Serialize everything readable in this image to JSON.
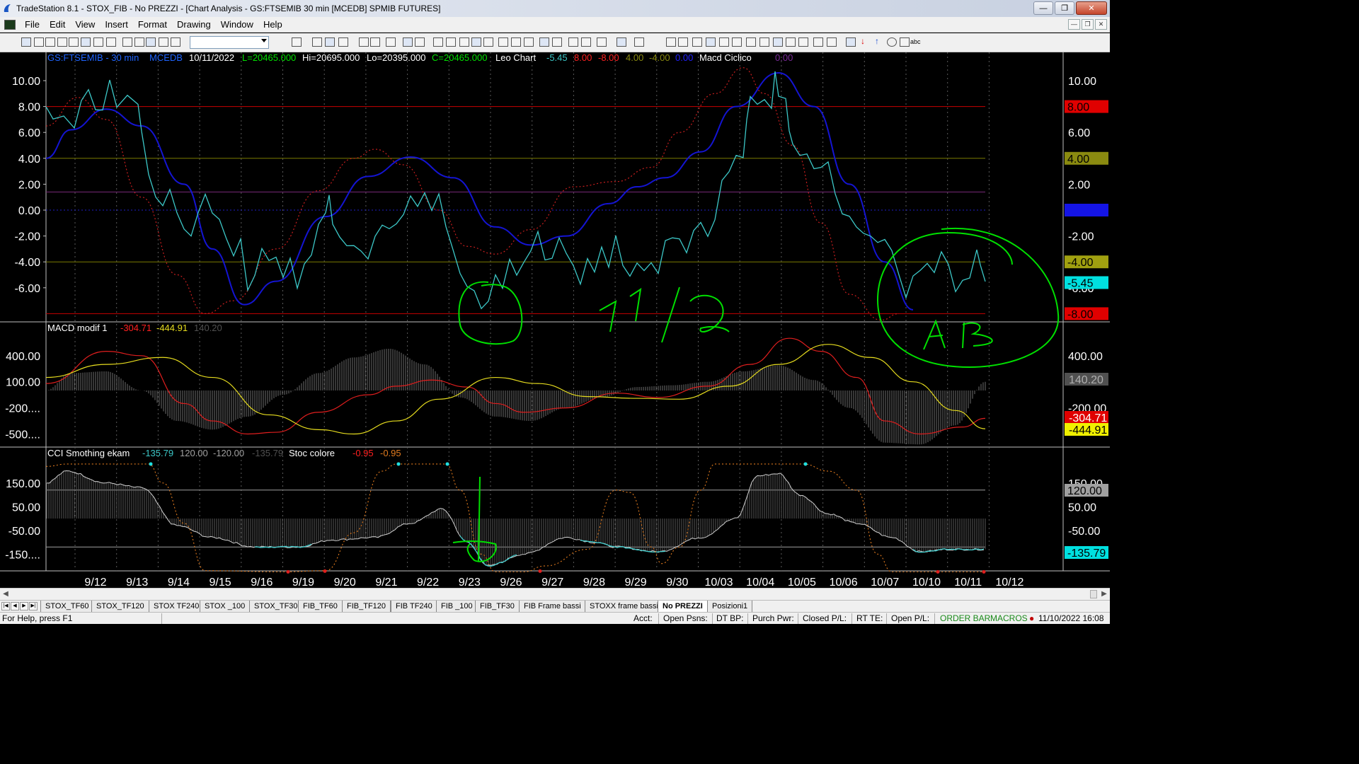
{
  "window": {
    "title": "TradeStation 8.1 - STOX_FIB - No PREZZI - [Chart Analysis - GS:FTSEMIB  30 min  [MCEDB] SPMIB FUTURES]",
    "buttons": [
      "minimize",
      "maximize",
      "close"
    ]
  },
  "menu": [
    "File",
    "Edit",
    "View",
    "Insert",
    "Format",
    "Drawing",
    "Window",
    "Help"
  ],
  "toolbar": {
    "text_tool": "abc",
    "symbol_combo": ""
  },
  "chart": {
    "price_header": {
      "symbol": "GS:FTSEMIB - 30 min",
      "feed": "MCEDB",
      "date": "10/11/2022",
      "last": "L=20465.000",
      "high": "Hi=20695.000",
      "low": "Lo=20395.000",
      "close": "C=20465.000",
      "study_name": "Leo Chart",
      "values": [
        "-5.45",
        "8.00",
        "-8.00",
        "4.00",
        "-4.00",
        "0.00"
      ],
      "study2_name": "Macd Ciclico",
      "study2_value": "0.00"
    },
    "macd_header": {
      "name": "MACD modif 1",
      "values": [
        "-304.71",
        "-444.91",
        "140.20"
      ]
    },
    "cci_header": {
      "name": "CCI Smothing ekam",
      "values": [
        "-135.79",
        "120.00",
        "-120.00",
        "-135.79"
      ],
      "stoc_name": "Stoc colore",
      "stoc_values": [
        "-0.95",
        "-0.95"
      ]
    },
    "price_axis": [
      "10.00",
      "8.00",
      "6.00",
      "4.00",
      "2.00",
      "0.00",
      "-2.00",
      "-4.00",
      "-6.00"
    ],
    "price_right_axis": [
      "10.00",
      "6.00",
      "2.00",
      "-2.00",
      "-6.00"
    ],
    "price_right_badges": [
      "8.00",
      "4.00",
      "0.00",
      "-4.00",
      "-5.45",
      "-8.00"
    ],
    "macd_axis": [
      "400.00",
      "100.00",
      "-200....",
      "-500...."
    ],
    "macd_right_axis": [
      "400.00",
      "-200.00"
    ],
    "macd_right_badges": [
      "140.20",
      "-304.71",
      "-444.91"
    ],
    "cci_axis": [
      "150.00",
      "50.00",
      "-50.00",
      "-150...."
    ],
    "cci_right_axis": [
      "150.00",
      "50.00",
      "-50.00"
    ],
    "cci_right_badges": [
      "120.00",
      "-135.79"
    ],
    "date_axis": [
      "9/12",
      "9/13",
      "9/14",
      "9/15",
      "9/16",
      "9/19",
      "9/20",
      "9/21",
      "9/22",
      "9/23",
      "9/26",
      "9/27",
      "9/28",
      "9/29",
      "9/30",
      "10/03",
      "10/04",
      "10/05",
      "10/06",
      "10/07",
      "10/10",
      "10/11",
      "10/12"
    ],
    "colors": {
      "cyan": "#3cc8c8",
      "blue": "#1414d2",
      "red_dotted": "#c81e1e",
      "macd_red": "#e01e1e",
      "macd_yellow": "#e6dc1e",
      "hline_red": "#c80000",
      "hline_olive": "#7a7a00",
      "hline_purple": "#7a2a7a",
      "hline_blue": "#1e1ec8",
      "annotation_green": "#00e000"
    }
  },
  "tabs": [
    "STOX_TF60",
    "STOX_TF120",
    "STOX TF240",
    "STOX _100",
    "STOX_TF30",
    "FIB_TF60",
    "FIB_TF120",
    "FIB TF240",
    "FIB _100",
    "FIB_TF30",
    "FIB Frame bassi",
    "STOXX frame bassi",
    "No PREZZI",
    "Posizioni1"
  ],
  "active_tab": "No PREZZI",
  "status": {
    "help": "For Help, press F1",
    "acct": "Acct:",
    "open_psns": "Open Psns:",
    "dt_bp": "DT BP:",
    "purch_pwr": "Purch Pwr:",
    "closed_pl": "Closed P/L:",
    "rt_te": "RT TE:",
    "open_pl": "Open P/L:",
    "order_bar": "ORDER BAR",
    "macros": "MACROS",
    "datetime": "11/10/2022 16:08"
  }
}
